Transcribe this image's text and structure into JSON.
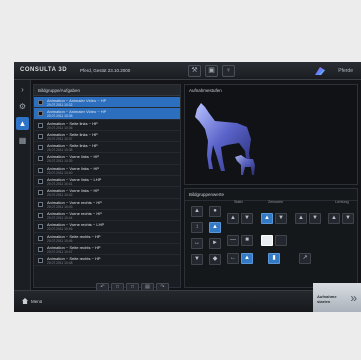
{
  "app": {
    "brand": "CONSULTA 3D",
    "patient": "Pferd, Gestüt 23.10.2000"
  },
  "toolbar": {
    "icons": [
      "tools-icon",
      "save-icon",
      "person-icon"
    ],
    "glyphs": [
      "⚒",
      "▣",
      "♀"
    ],
    "logo_text": "Pferde"
  },
  "rail": {
    "items": [
      {
        "name": "collapse-icon",
        "glyph": "›",
        "active": false
      },
      {
        "name": "settings-icon",
        "glyph": "⚙",
        "active": false
      },
      {
        "name": "view-icon",
        "glyph": "▲",
        "active": true
      },
      {
        "name": "library-icon",
        "glyph": "▦",
        "active": false
      }
    ]
  },
  "list": {
    "header": "Bildgruppe/Aufgaben",
    "items": [
      {
        "name": "Animation ~ Animaier Video ~ HP",
        "sub": "20.07.2011 10:32",
        "selected": true
      },
      {
        "name": "Animation ~ Animaier Video ~ HP",
        "sub": "20.07.2011 10:35",
        "selected": true
      },
      {
        "name": "Animation ~ Seite links ~ HP",
        "sub": "20.07.2011 10:36",
        "selected": false
      },
      {
        "name": "Animation ~ Seite links ~ HP",
        "sub": "20.07.2011 10:37",
        "selected": false
      },
      {
        "name": "Animation ~ Seite links ~ HP",
        "sub": "20.07.2011 10:38",
        "selected": false
      },
      {
        "name": "Animation ~ Vorne links ~ HP",
        "sub": "20.07.2011 10:39",
        "selected": false
      },
      {
        "name": "Animation ~ Vorne links ~ HP",
        "sub": "20.07.2011 10:40",
        "selected": false
      },
      {
        "name": "Animation ~ Vorne links ~ LHP",
        "sub": "20.07.2011 10:41",
        "selected": false
      },
      {
        "name": "Animation ~ Vorne links ~ HP",
        "sub": "20.07.2011 10:42",
        "selected": false
      },
      {
        "name": "Animation ~ Vorne rechts ~ HP",
        "sub": "20.07.2011 10:43",
        "selected": false
      },
      {
        "name": "Animation ~ Vorne rechts ~ HP",
        "sub": "20.07.2011 10:44",
        "selected": false
      },
      {
        "name": "Animation ~ Vorne rechts ~ LHP",
        "sub": "20.07.2011 10:45",
        "selected": false
      },
      {
        "name": "Animation ~ Seite rechts ~ HP",
        "sub": "20.07.2011 10:46",
        "selected": false
      },
      {
        "name": "Animation ~ Seite rechts ~ HP",
        "sub": "20.07.2011 10:47",
        "selected": false
      },
      {
        "name": "Animation ~ Seite rechts ~ HP",
        "sub": "20.07.2011 10:48",
        "selected": false
      }
    ],
    "tools": [
      "↶",
      "□",
      "□",
      "▤",
      "↷"
    ]
  },
  "preview": {
    "title": "Aufnahmestufen"
  },
  "settings": {
    "title": "Bildgruppenwerte",
    "col_heads": [
      "Stativ",
      "Zensoren",
      "Lichtung"
    ]
  },
  "bottom": {
    "menu_label": "Menü",
    "next_label": "Aufnahme starten",
    "next_glyph": "»"
  }
}
